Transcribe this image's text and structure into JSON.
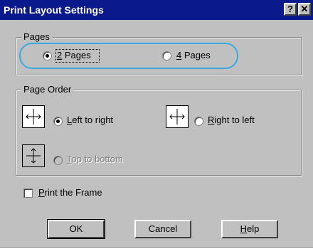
{
  "dialog": {
    "title": "Print Layout Settings",
    "help_glyph": "?",
    "close_glyph": "✕"
  },
  "pages": {
    "legend": "Pages",
    "option_2": {
      "label_accel": "2",
      "label_rest": " Pages",
      "checked": true
    },
    "option_4": {
      "label_accel": "4",
      "label_rest": " Pages",
      "checked": false
    }
  },
  "page_order": {
    "legend": "Page Order",
    "left_to_right": {
      "label_accel": "L",
      "label_rest": "eft to right",
      "checked": true,
      "icon": "arrow-left-right-icon"
    },
    "right_to_left": {
      "label_accel": "R",
      "label_rest": "ight to left",
      "checked": false,
      "icon": "arrow-right-left-icon"
    },
    "top_to_bottom": {
      "label_accel": "T",
      "label_rest": "op to bottom",
      "checked": false,
      "disabled": true,
      "icon": "arrow-top-bottom-icon"
    }
  },
  "print_frame": {
    "label_accel": "P",
    "label_rest": "rint the Frame",
    "checked": false
  },
  "buttons": {
    "ok": "OK",
    "cancel": "Cancel",
    "help_accel": "H",
    "help_rest": "elp"
  },
  "colors": {
    "titlebar": "#0a1a8c",
    "face": "#c0c0c0",
    "highlight_ring": "#3aa9e0"
  }
}
